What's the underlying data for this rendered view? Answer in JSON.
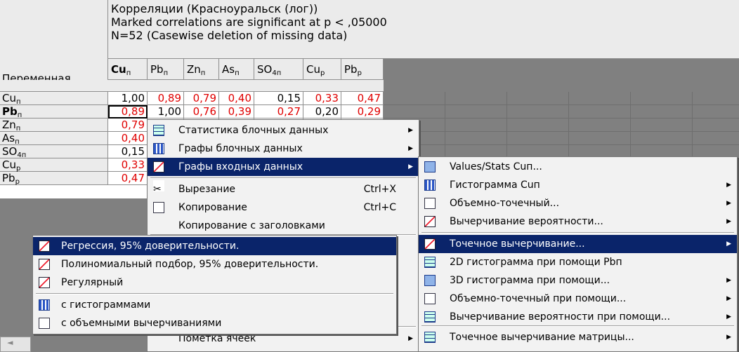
{
  "header": {
    "line1": "Корреляции (Красноуральск (лог))",
    "line2": "Marked correlations are significant at p < ,05000",
    "line3": "N=52 (Casewise deletion of missing data)"
  },
  "corner_label": "Переменная",
  "columns": [
    {
      "base": "Cu",
      "sub": "п"
    },
    {
      "base": "Pb",
      "sub": "п"
    },
    {
      "base": "Zn",
      "sub": "п"
    },
    {
      "base": "As",
      "sub": "п"
    },
    {
      "base": "SO",
      "sub": "4п"
    },
    {
      "base": "Cu",
      "sub": "р"
    },
    {
      "base": "Pb",
      "sub": "р"
    }
  ],
  "rows": [
    {
      "base": "Cu",
      "sub": "п"
    },
    {
      "base": "Pb",
      "sub": "п"
    },
    {
      "base": "Zn",
      "sub": "п"
    },
    {
      "base": "As",
      "sub": "п"
    },
    {
      "base": "SO",
      "sub": "4п"
    },
    {
      "base": "Cu",
      "sub": "р"
    },
    {
      "base": "Pb",
      "sub": "р"
    }
  ],
  "cells": [
    [
      {
        "v": "1,00",
        "red": false
      },
      {
        "v": "0,89",
        "red": true
      },
      {
        "v": "0,79",
        "red": true
      },
      {
        "v": "0,40",
        "red": true
      },
      {
        "v": "0,15",
        "red": false
      },
      {
        "v": "0,33",
        "red": true
      },
      {
        "v": "0,47",
        "red": true
      }
    ],
    [
      {
        "v": "0,89",
        "red": true
      },
      {
        "v": "1,00",
        "red": false
      },
      {
        "v": "0,76",
        "red": true
      },
      {
        "v": "0,39",
        "red": true
      },
      {
        "v": "0,27",
        "red": true
      },
      {
        "v": "0,20",
        "red": false
      },
      {
        "v": "0,29",
        "red": true
      }
    ],
    [
      {
        "v": "0,79",
        "red": true
      }
    ],
    [
      {
        "v": "0,40",
        "red": true
      }
    ],
    [
      {
        "v": "0,15",
        "red": false
      }
    ],
    [
      {
        "v": "0,33",
        "red": true
      }
    ],
    [
      {
        "v": "0,47",
        "red": true
      }
    ]
  ],
  "context_menu": {
    "items": [
      {
        "label": "Статистика блочных данных",
        "icon": "table-stats-icon",
        "arrow": true
      },
      {
        "label": "Графы блочных данных",
        "icon": "bar-chart-icon",
        "arrow": true
      },
      {
        "label": "Графы входных данных",
        "icon": "graph-input-icon",
        "arrow": true,
        "selected": true
      },
      {
        "label": "Вырезание",
        "icon": "scissors-icon",
        "shortcut": "Ctrl+X"
      },
      {
        "label": "Копирование",
        "icon": "copy-icon",
        "shortcut": "Ctrl+C"
      },
      {
        "label": "Копирование с заголовками",
        "icon": ""
      },
      {
        "label": "Пометка ячеек",
        "icon": "",
        "arrow": true
      }
    ]
  },
  "submenu_input_graphs": {
    "items": [
      {
        "label": "Values/Stats Cuп...",
        "icon": "values-stats-icon",
        "arrow": false
      },
      {
        "label": "Гистограмма Cuп",
        "icon": "histogram-icon",
        "arrow": true
      },
      {
        "label": "Объемно-точечный...",
        "icon": "scatter3d-icon",
        "arrow": true
      },
      {
        "label": "Вычерчивание вероятности...",
        "icon": "probability-plot-icon",
        "arrow": true
      },
      {
        "label": "Точечное вычерчивание...",
        "icon": "scatterplot-icon",
        "arrow": true,
        "selected": true
      },
      {
        "label": "2D гистограмма при помощи Pbп",
        "icon": "histogram-2d-icon",
        "arrow": false
      },
      {
        "label": "3D гистограмма при помощи...",
        "icon": "histogram-3d-icon",
        "arrow": true
      },
      {
        "label": "Объемно-точечный при помощи...",
        "icon": "scatter3d-by-icon",
        "arrow": true
      },
      {
        "label": "Вычерчивание вероятности при помощи...",
        "icon": "probability-by-icon",
        "arrow": true
      },
      {
        "label": "Точечное вычерчивание матрицы...",
        "icon": "matrix-plot-icon",
        "arrow": true
      }
    ]
  },
  "submenu_scatter": {
    "items": [
      {
        "label": "Регрессия, 95% доверительности.",
        "icon": "regression-icon",
        "selected": true
      },
      {
        "label": "Полиномиальный подбор, 95% доверительности.",
        "icon": "polynomial-fit-icon"
      },
      {
        "label": "Регулярный",
        "icon": "regular-scatter-icon"
      },
      {
        "label": "с гистограммами",
        "icon": "with-histograms-icon"
      },
      {
        "label": "с объемными вычерчиваниями",
        "icon": "with-box-plots-icon"
      }
    ]
  },
  "scrollbar": {
    "left_arrow": "◄"
  },
  "colors": {
    "selection": "#0a246a",
    "significant": "#e00000",
    "menu_bg": "#f2f2f2",
    "grid_gray": "#808080"
  }
}
